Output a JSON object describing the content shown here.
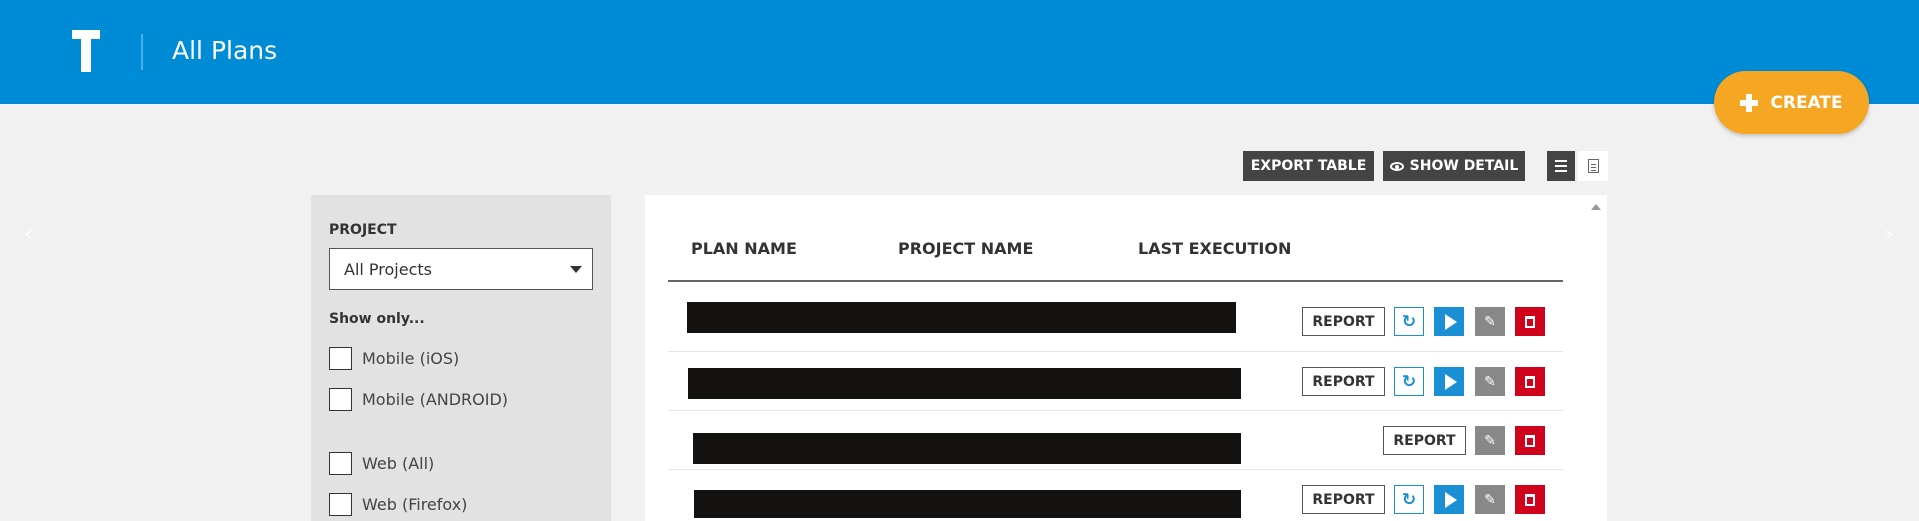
{
  "header": {
    "title": "All Plans",
    "create_label": "CREATE"
  },
  "toolbar": {
    "export_label": "EXPORT TABLE",
    "show_detail_label": "SHOW DETAIL"
  },
  "filters": {
    "project_label": "PROJECT",
    "project_selected": "All Projects",
    "show_only_label": "Show only...",
    "options": [
      "Mobile (iOS)",
      "Mobile (ANDROID)",
      "Web (All)",
      "Web (Firefox)"
    ]
  },
  "table": {
    "columns": [
      "PLAN NAME",
      "PROJECT NAME",
      "LAST EXECUTION"
    ],
    "report_label": "REPORT"
  },
  "colors": {
    "header": "#008bd6",
    "accent": "#f5a623",
    "primary": "#1a8fd6",
    "danger": "#d0021b"
  }
}
